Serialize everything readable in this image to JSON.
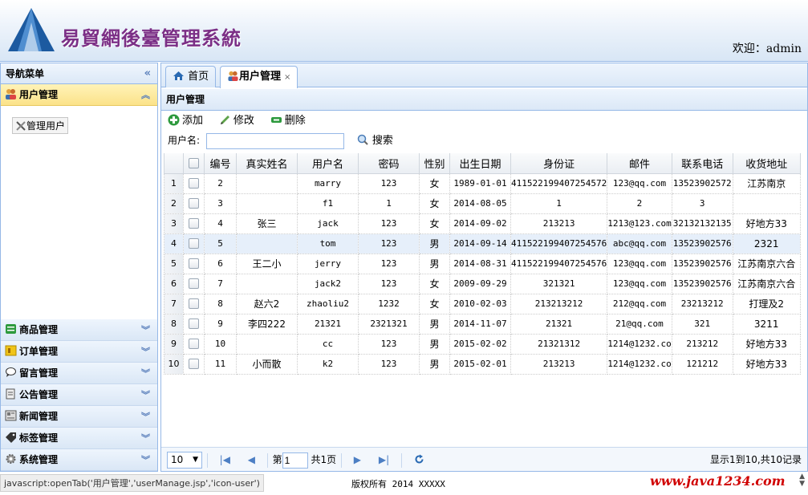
{
  "header": {
    "title": "易貿網後臺管理系統",
    "welcome": "欢迎：admin"
  },
  "nav": {
    "title": "导航菜单",
    "active_section": "用户管理",
    "tree_item": "管理用户",
    "sections": [
      "商品管理",
      "订单管理",
      "留言管理",
      "公告管理",
      "新闻管理",
      "标签管理",
      "系统管理"
    ]
  },
  "tabs": [
    {
      "label": "首页"
    },
    {
      "label": "用户管理",
      "close": "×"
    }
  ],
  "panel": {
    "title": "用户管理"
  },
  "toolbar": {
    "add": "添加",
    "edit": "修改",
    "delete": "删除"
  },
  "search": {
    "label": "用户名:",
    "value": "",
    "button": "搜索"
  },
  "table": {
    "columns": [
      "编号",
      "真实姓名",
      "用户名",
      "密码",
      "性别",
      "出生日期",
      "身份证",
      "邮件",
      "联系电话",
      "收货地址"
    ],
    "rows": [
      [
        "2",
        "",
        "marry",
        "123",
        "女",
        "1989-01-01",
        "411522199407254572",
        "123@qq.com",
        "13523902572",
        "江苏南京"
      ],
      [
        "3",
        "",
        "f1",
        "1",
        "女",
        "2014-08-05",
        "1",
        "2",
        "3",
        ""
      ],
      [
        "4",
        "张三",
        "jack",
        "123",
        "女",
        "2014-09-02",
        "213213",
        "1213@123.com",
        "32132132135",
        "好地方33"
      ],
      [
        "5",
        "",
        "tom",
        "123",
        "男",
        "2014-09-14",
        "411522199407254576",
        "abc@qq.com",
        "13523902576",
        "2321"
      ],
      [
        "6",
        "王二小",
        "jerry",
        "123",
        "男",
        "2014-08-31",
        "411522199407254576",
        "123@qq.com",
        "13523902576",
        "江苏南京六合"
      ],
      [
        "7",
        "",
        "jack2",
        "123",
        "女",
        "2009-09-29",
        "321321",
        "123@qq.com",
        "13523902576",
        "江苏南京六合"
      ],
      [
        "8",
        "赵六2",
        "zhaoliu2",
        "1232",
        "女",
        "2010-02-03",
        "213213212",
        "212@qq.com",
        "23213212",
        "打理及2"
      ],
      [
        "9",
        "李四222",
        "21321",
        "2321321",
        "男",
        "2014-11-07",
        "21321",
        "21@qq.com",
        "321",
        "3211"
      ],
      [
        "10",
        "",
        "cc",
        "123",
        "男",
        "2015-02-02",
        "21321312",
        "1214@1232.co",
        "213212",
        "好地方33"
      ],
      [
        "11",
        "小而散",
        "k2",
        "123",
        "男",
        "2015-02-01",
        "213213",
        "1214@1232.co",
        "121212",
        "好地方33"
      ]
    ]
  },
  "pager": {
    "page_size": "10",
    "page_prefix": "第",
    "page": "1",
    "page_total": "共1页",
    "info": "显示1到10,共10记录"
  },
  "status": {
    "url": "javascript:openTab('用户管理','userManage.jsp','icon-user')",
    "copyright": "版权所有 2014 XXXXX",
    "watermark": "www.java1234.com"
  }
}
